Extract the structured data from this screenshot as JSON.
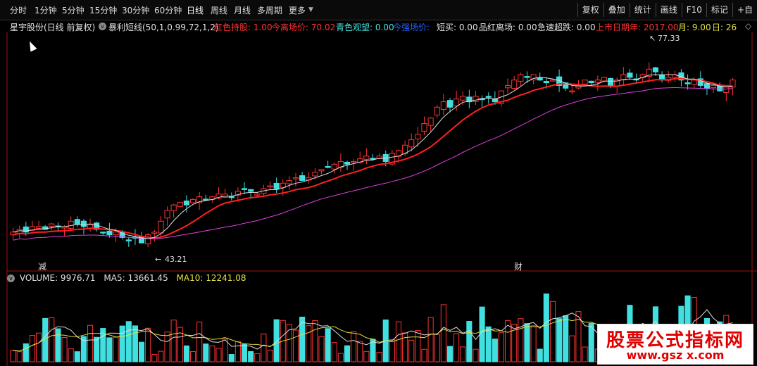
{
  "periods": [
    "分时",
    "1分钟",
    "5分钟",
    "15分钟",
    "30分钟",
    "60分钟",
    "日线",
    "周线",
    "月线",
    "多周期",
    "更多"
  ],
  "active_period": "日线",
  "right_tools": [
    "复权",
    "叠加",
    "统计",
    "画线",
    "F10",
    "标记",
    "+自"
  ],
  "stock": {
    "name_label": "星宇股份(日线 前复权)",
    "indicator": "暴利短线(50,1,0.99,72,1,2)"
  },
  "indicator_values": [
    {
      "text": "红色持股: 1.00",
      "color": "#ff3030"
    },
    {
      "text": "今离场价: 70.02",
      "color": "#ff3030"
    },
    {
      "text": "青色观望: 0.00",
      "color": "#40e0e0"
    },
    {
      "text": "今强场价:",
      "color": "#2060ff"
    },
    {
      "text": "短买: 0.00",
      "color": "#e0e0e0"
    },
    {
      "text": "品红离场: 0.00",
      "color": "#e0e0e0"
    },
    {
      "text": "急速超跌: 0.00",
      "color": "#e0e0e0"
    },
    {
      "text": "上市日期年: 2017.00",
      "color": "#ff3030"
    },
    {
      "text": "月: 9.00",
      "color": "#e0e040"
    },
    {
      "text": "日: 26",
      "color": "#e0e040"
    }
  ],
  "annotations": {
    "high": "77.33",
    "low": "43.21",
    "marker_left": "减",
    "marker_right": "财"
  },
  "volume_info": {
    "volume": "VOLUME: 9976.71",
    "ma5": "MA5: 13661.45",
    "ma10": "MA10: 12241.08"
  },
  "watermark": {
    "title": "股票公式指标网",
    "url": "www.gsz x.com"
  },
  "colors": {
    "up": "#ff3232",
    "down": "#40e0e0",
    "ma_red": "#ff2020",
    "ma_magenta": "#e040e0",
    "ma_white": "#e0e0e0",
    "ma_yellow": "#e0e040",
    "grid_red": "#a01010"
  },
  "chart_data": {
    "type": "candlestick",
    "y_range": [
      40,
      82
    ],
    "close_trend": [
      46,
      46.5,
      46,
      47,
      47,
      46.5,
      47.5,
      47,
      47,
      48,
      47.5,
      47,
      47.5,
      46.5,
      46,
      45.5,
      46,
      45,
      44.5,
      45,
      44,
      45.5,
      46,
      48,
      50,
      51,
      51.5,
      51,
      52,
      52.5,
      52,
      52.5,
      53,
      53,
      52.5,
      53.5,
      54,
      53.5,
      53,
      54,
      54.5,
      54,
      55,
      55.5,
      56,
      55.5,
      56,
      57,
      57.5,
      58,
      58.5,
      59,
      58.5,
      59,
      59.5,
      60,
      59.5,
      60,
      59,
      60.5,
      61,
      62,
      63,
      64,
      66,
      67,
      69,
      70,
      69,
      70.5,
      71,
      70,
      71,
      70.5,
      71,
      70,
      72,
      73,
      74,
      75,
      74.5,
      75,
      74,
      73.5,
      74,
      73,
      72.5,
      72,
      73,
      74,
      73.5,
      74,
      74.5,
      73,
      74,
      75,
      74.5,
      74,
      75,
      76,
      75.5,
      74,
      74.5,
      75,
      74,
      73.5,
      74,
      73,
      72.5,
      73,
      72,
      73,
      74
    ]
  }
}
